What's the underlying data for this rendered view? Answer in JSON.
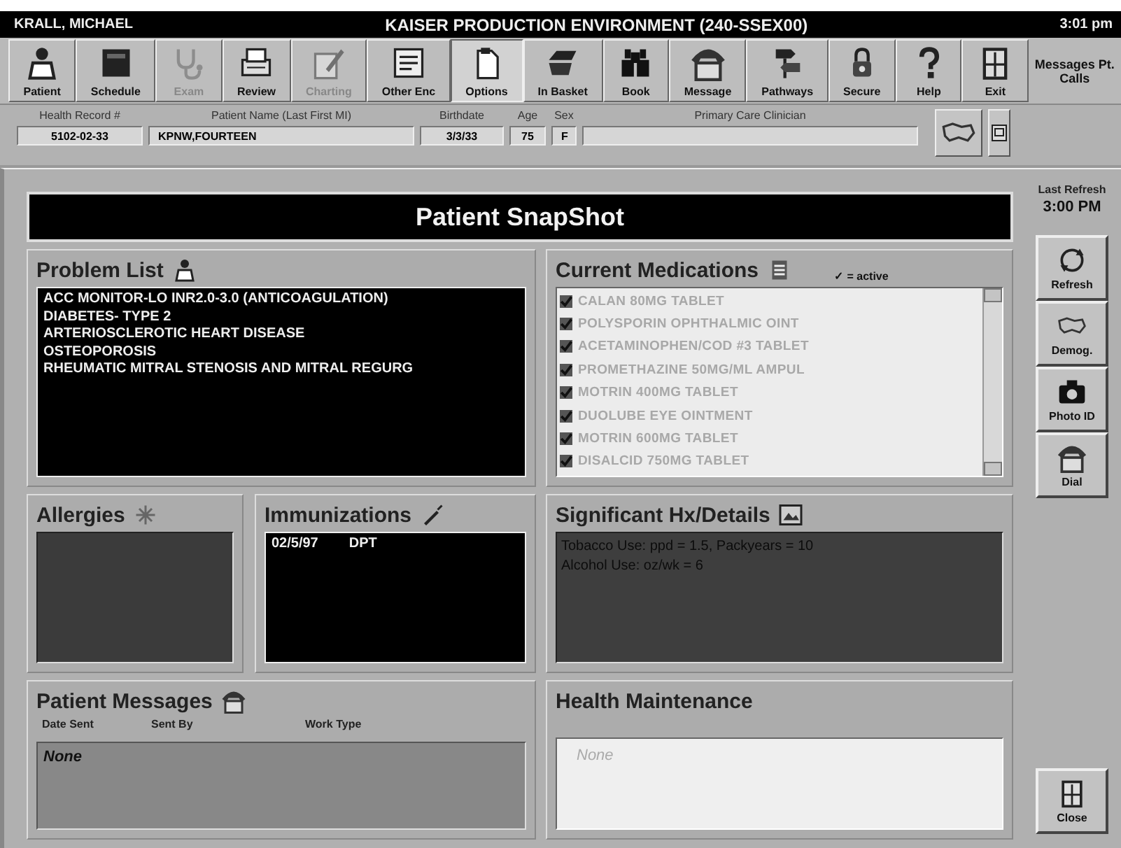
{
  "title_bar": {
    "user": "KRALL, MICHAEL",
    "environment": "KAISER PRODUCTION ENVIRONMENT (240-SSEX00)",
    "time": "3:01 pm"
  },
  "toolbar": [
    {
      "label": "Patient",
      "disabled": false,
      "selected": false
    },
    {
      "label": "Schedule",
      "disabled": false,
      "selected": false
    },
    {
      "label": "Exam",
      "disabled": true,
      "selected": false
    },
    {
      "label": "Review",
      "disabled": false,
      "selected": false
    },
    {
      "label": "Charting",
      "disabled": true,
      "selected": false
    },
    {
      "label": "Other Enc",
      "disabled": false,
      "selected": false
    },
    {
      "label": "Options",
      "disabled": false,
      "selected": true
    },
    {
      "label": "In Basket",
      "disabled": false,
      "selected": false
    },
    {
      "label": "Book",
      "disabled": false,
      "selected": false
    },
    {
      "label": "Message",
      "disabled": false,
      "selected": false
    },
    {
      "label": "Pathways",
      "disabled": false,
      "selected": false
    },
    {
      "label": "Secure",
      "disabled": false,
      "selected": false
    },
    {
      "label": "Help",
      "disabled": false,
      "selected": false
    },
    {
      "label": "Exit",
      "disabled": false,
      "selected": false
    }
  ],
  "messages_button": {
    "label": "Messages Pt. Calls"
  },
  "patient_header": {
    "fields": [
      {
        "label": "Health Record #",
        "value": "5102-02-33"
      },
      {
        "label": "Patient Name (Last First MI)",
        "value": "KPNW,FOURTEEN"
      },
      {
        "label": "Birthdate",
        "value": "3/3/33"
      },
      {
        "label": "Age",
        "value": "75"
      },
      {
        "label": "Sex",
        "value": "F"
      },
      {
        "label": "Primary Care Clinician"
      }
    ]
  },
  "snapshot": {
    "title": "Patient SnapShot",
    "last_refresh_label": "Last Refresh",
    "last_refresh_time": "3:00 PM"
  },
  "problem_list": {
    "title": "Problem List",
    "items": [
      "ACC MONITOR-LO INR2.0-3.0 (ANTICOAGULATION)",
      "DIABETES- TYPE 2",
      "ARTERIOSCLEROTIC HEART DISEASE",
      "OSTEOPOROSIS",
      "RHEUMATIC MITRAL STENOSIS AND MITRAL REGURG"
    ]
  },
  "medications": {
    "title": "Current Medications",
    "legend": "✓ = active",
    "items": [
      {
        "name": "CALAN 80MG TABLET",
        "checked": true
      },
      {
        "name": "POLYSPORIN OPHTHALMIC OINT",
        "checked": true
      },
      {
        "name": "ACETAMINOPHEN/COD #3 TABLET",
        "checked": true
      },
      {
        "name": "PROMETHAZINE 50MG/ML AMPUL",
        "checked": true
      },
      {
        "name": "MOTRIN 400MG TABLET",
        "checked": true
      },
      {
        "name": "DUOLUBE EYE OINTMENT",
        "checked": true
      },
      {
        "name": "MOTRIN 600MG TABLET",
        "checked": true
      },
      {
        "name": "DISALCID 750MG TABLET",
        "checked": true
      }
    ]
  },
  "allergies": {
    "title": "Allergies"
  },
  "immunizations": {
    "title": "Immunizations",
    "rows": [
      {
        "date": "02/5/97",
        "vaccine": "DPT"
      }
    ]
  },
  "significant_hx": {
    "title": "Significant Hx/Details",
    "lines": [
      "Tobacco Use: ppd = 1.5, Packyears = 10",
      "Alcohol Use: oz/wk = 6"
    ]
  },
  "patient_messages": {
    "title": "Patient Messages",
    "columns": [
      "Date Sent",
      "Sent By",
      "Work Type"
    ],
    "empty_text": "None"
  },
  "health_maintenance": {
    "title": "Health Maintenance",
    "empty_text": "None"
  },
  "side_buttons": [
    {
      "label": "Refresh",
      "kind": "refresh"
    },
    {
      "label": "Demog.",
      "kind": "map"
    },
    {
      "label": "Photo ID",
      "kind": "camera"
    },
    {
      "label": "Dial",
      "kind": "phone"
    }
  ],
  "close_button": {
    "label": "Close",
    "kind": "door"
  }
}
